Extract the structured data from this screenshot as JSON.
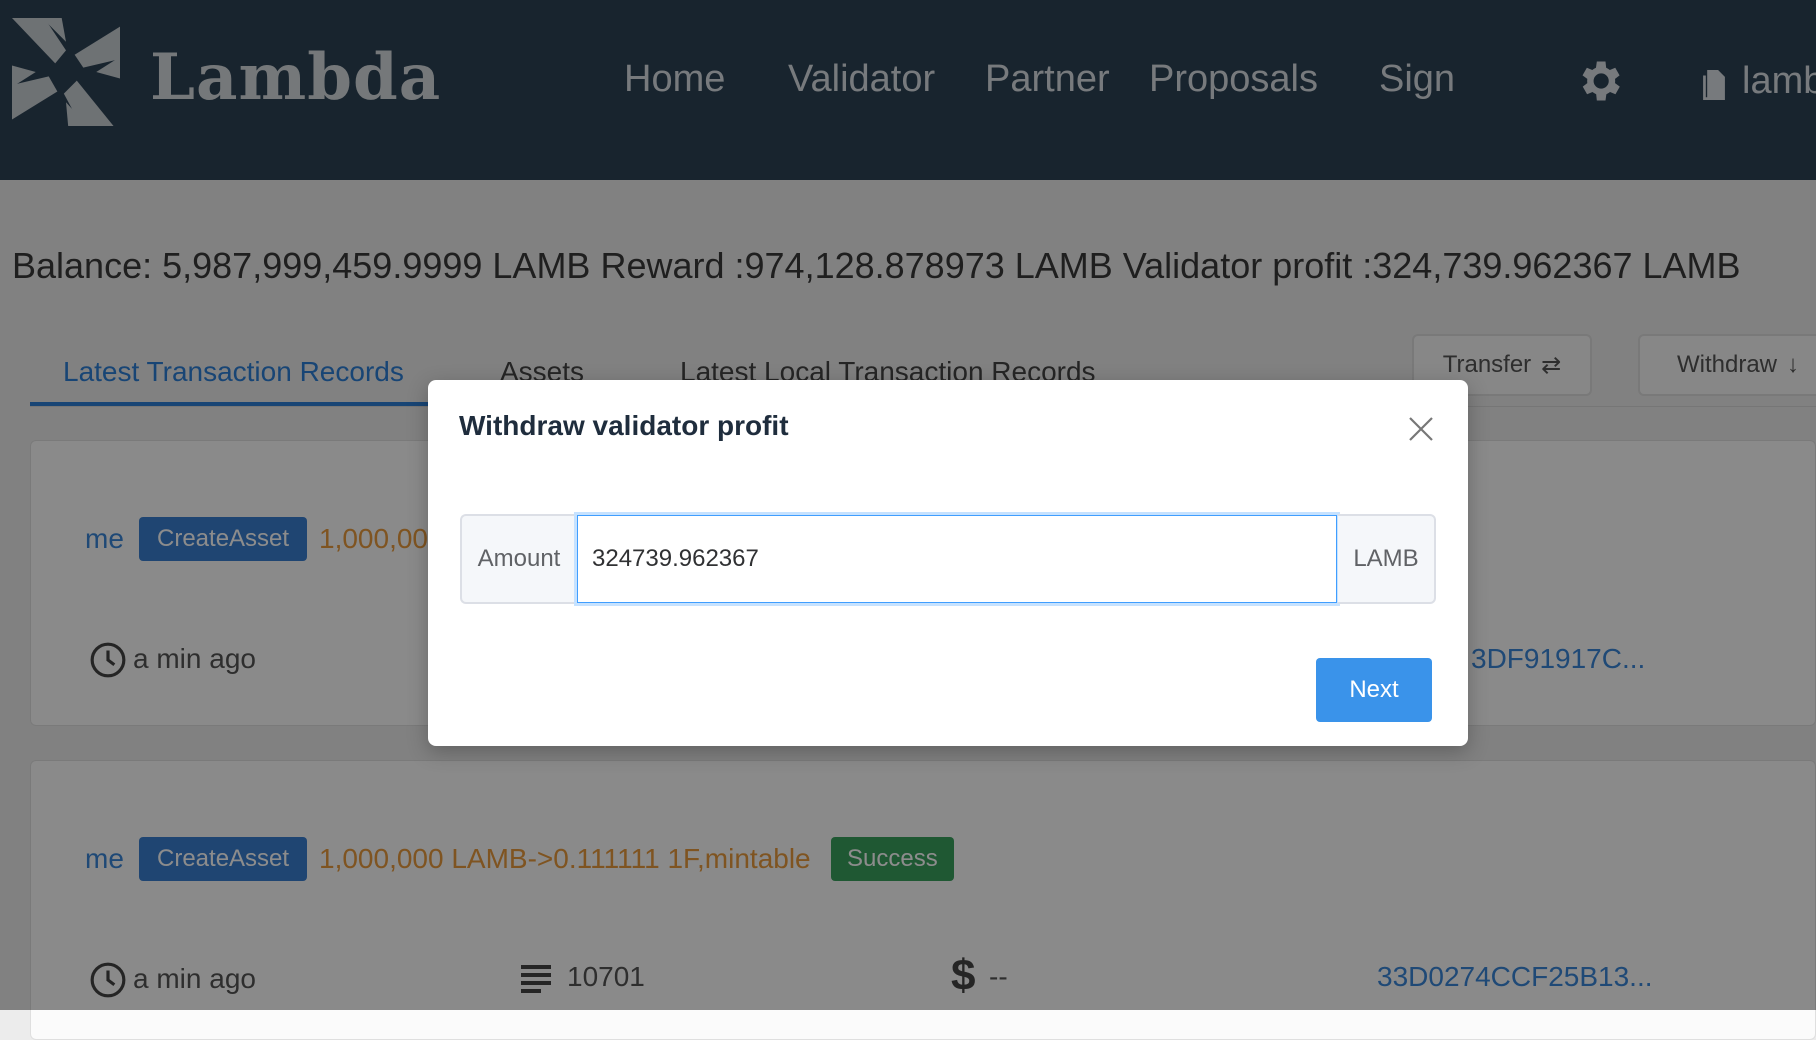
{
  "header": {
    "logo_text": "Lambda",
    "nav": [
      "Home",
      "Validator",
      "Partner",
      "Proposals",
      "Sign"
    ],
    "user_label": "lamb"
  },
  "balance_line": "Balance: 5,987,999,459.9999 LAMB Reward :974,128.878973 LAMB Validator profit :324,739.962367 LAMB",
  "tabs": [
    "Latest Transaction Records",
    "Assets",
    "Latest Local Transaction Records"
  ],
  "actions": {
    "transfer_label": "Transfer",
    "withdraw_label": "Withdraw"
  },
  "records": [
    {
      "who": "me",
      "type": "CreateAsset",
      "amount": "1,000,00",
      "time": "a min ago",
      "hash": "3DF91917C..."
    },
    {
      "who": "me",
      "type": "CreateAsset",
      "amount": "1,000,000 LAMB->0.111111 1F,mintable",
      "status": "Success",
      "time": "a min ago",
      "height": "10701",
      "fee": "--",
      "hash": "33D0274CCF25B13..."
    }
  ],
  "modal": {
    "title": "Withdraw validator profit",
    "amount_label": "Amount",
    "amount_value": "324739.962367",
    "unit": "LAMB",
    "next_label": "Next"
  },
  "colors": {
    "header_bg": "#2c4254",
    "accent": "#3a93ea",
    "success": "#3aa05e",
    "amount_orange": "#e89a3c"
  }
}
